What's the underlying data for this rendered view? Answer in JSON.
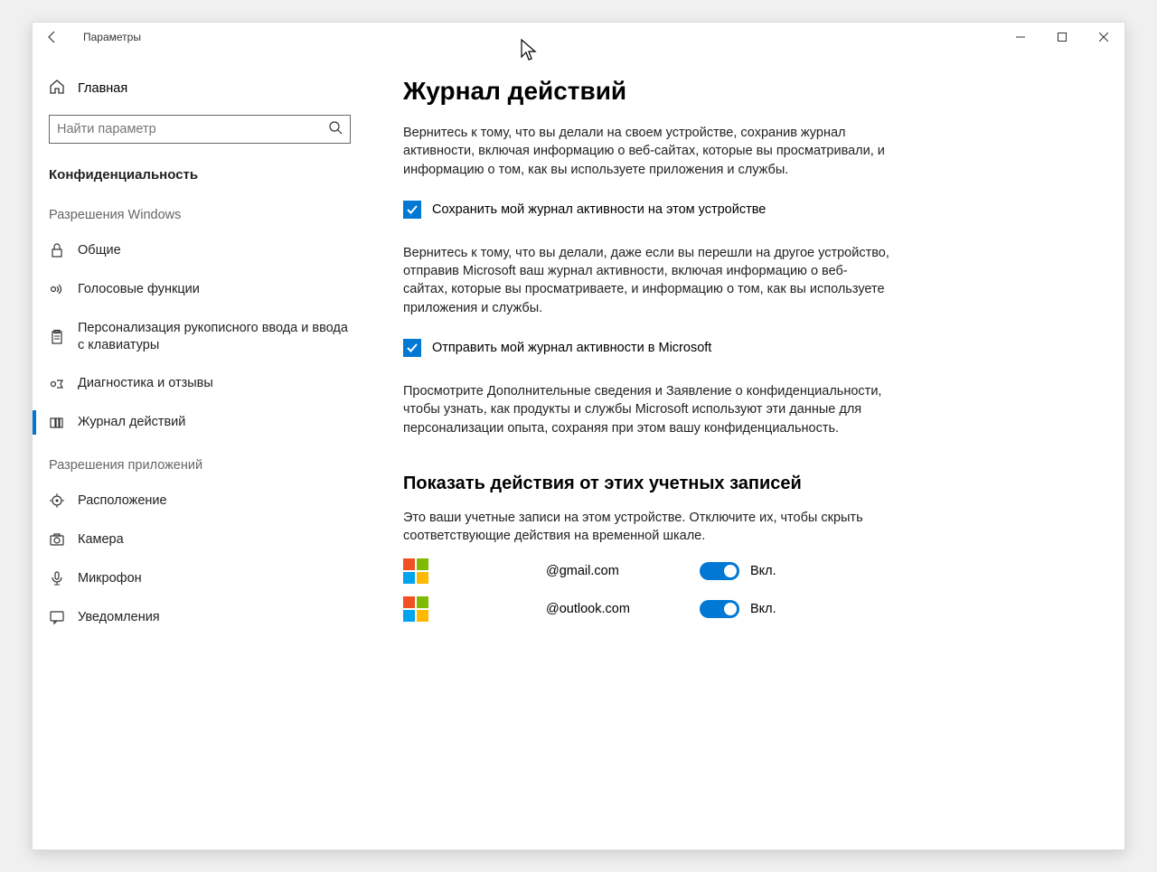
{
  "window": {
    "title": "Параметры"
  },
  "sidebar": {
    "home_label": "Главная",
    "search_placeholder": "Найти параметр",
    "section_title": "Конфиденциальность",
    "group_windows": "Разрешения Windows",
    "group_apps": "Разрешения приложений",
    "items_windows": [
      {
        "label": "Общие"
      },
      {
        "label": "Голосовые функции"
      },
      {
        "label": "Персонализация рукописного ввода и ввода с клавиатуры"
      },
      {
        "label": "Диагностика и отзывы"
      },
      {
        "label": "Журнал действий"
      }
    ],
    "items_apps": [
      {
        "label": "Расположение"
      },
      {
        "label": "Камера"
      },
      {
        "label": "Микрофон"
      },
      {
        "label": "Уведомления"
      }
    ]
  },
  "main": {
    "heading": "Журнал действий",
    "para1": "Вернитесь к тому, что вы делали на своем устройстве, сохранив журнал активности, включая информацию о веб-сайтах, которые вы просматривали, и информацию о том, как вы используете приложения и службы.",
    "checkbox1_label": "Сохранить мой журнал активности на этом устройстве",
    "para2": "Вернитесь к тому, что вы делали, даже если вы перешли на другое устройство, отправив Microsoft ваш журнал активности, включая информацию о веб-сайтах, которые вы просматриваете, и информацию о том, как вы используете приложения и службы.",
    "checkbox2_label": "Отправить мой журнал активности в Microsoft",
    "para3": "Просмотрите Дополнительные сведения и Заявление о конфиденциальности, чтобы узнать, как продукты и службы Microsoft используют эти данные для персонализации опыта, сохраняя при этом вашу конфиденциальность.",
    "subheading": "Показать действия от этих учетных записей",
    "accounts_intro": "Это ваши учетные записи на этом устройстве. Отключите их, чтобы скрыть соответствующие действия на временной шкале.",
    "accounts": [
      {
        "email": "@gmail.com",
        "state": "Вкл."
      },
      {
        "email": "@outlook.com",
        "state": "Вкл."
      }
    ]
  }
}
